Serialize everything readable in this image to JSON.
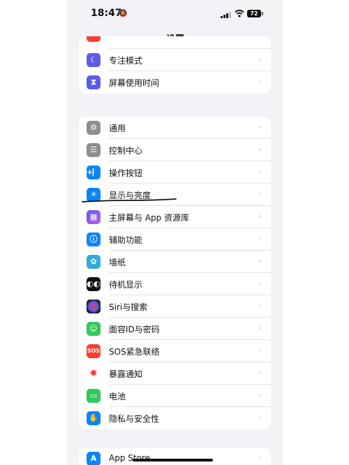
{
  "status_bar": {
    "time": "18:47",
    "battery": "72"
  },
  "nav": {
    "title": "设置"
  },
  "groups": [
    {
      "items": [
        {
          "label": "",
          "icon": "red-icon-partial",
          "color": "#ff3b30"
        },
        {
          "label": "专注模式",
          "icon": "moon-icon",
          "color": "#5e5ce6"
        },
        {
          "label": "屏幕使用时间",
          "icon": "hourglass-icon",
          "color": "#5e5ce6"
        }
      ]
    },
    {
      "items": [
        {
          "label": "通用",
          "icon": "gear-icon",
          "color": "#8e8e93"
        },
        {
          "label": "控制中心",
          "icon": "toggles-icon",
          "color": "#8e8e93"
        },
        {
          "label": "操作按钮",
          "icon": "action-button-icon",
          "color": "#0a84ff"
        },
        {
          "label": "显示与亮度",
          "icon": "sun-icon",
          "color": "#0a84ff"
        },
        {
          "label": "主屏幕与 App 资源库",
          "icon": "home-grid-icon",
          "color": "#5e5ce6"
        },
        {
          "label": "辅助功能",
          "icon": "accessibility-icon",
          "color": "#0a84ff"
        },
        {
          "label": "墙纸",
          "icon": "wallpaper-flower-icon",
          "color": "#34aadc"
        },
        {
          "label": "待机显示",
          "icon": "standby-icon",
          "color": "#111111"
        },
        {
          "label": "Siri与搜索",
          "icon": "siri-icon",
          "color": "#222222"
        },
        {
          "label": "面容ID与密码",
          "icon": "face-id-icon",
          "color": "#34c759"
        },
        {
          "label": "SOS紧急联络",
          "icon": "sos-icon",
          "color": "#ff3b30"
        },
        {
          "label": "暴露通知",
          "icon": "exposure-icon",
          "color": "#ffffff"
        },
        {
          "label": "电池",
          "icon": "battery-icon",
          "color": "#34c759"
        },
        {
          "label": "隐私与安全性",
          "icon": "hand-icon",
          "color": "#0a84ff"
        }
      ]
    },
    {
      "items": [
        {
          "label": "App Store",
          "icon": "app-store-icon",
          "color": "#0a84ff"
        }
      ]
    }
  ]
}
